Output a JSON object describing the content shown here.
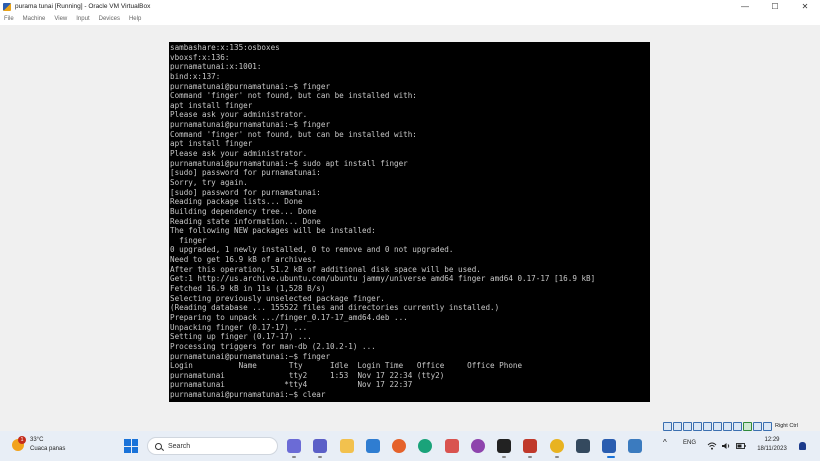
{
  "window": {
    "title": "purama tunai [Running] - Oracle VM VirtualBox",
    "controls": {
      "minimize": "—",
      "maximize": "☐",
      "close": "✕"
    }
  },
  "menubar": [
    "File",
    "Machine",
    "View",
    "Input",
    "Devices",
    "Help"
  ],
  "terminal": {
    "lines": [
      "sambashare:x:135:osboxes",
      "vboxsf:x:136:",
      "purnamatunai:x:1001:",
      "bind:x:137:",
      "purnamatunai@purnamatunai:~$ finger",
      "Command 'finger' not found, but can be installed with:",
      "apt install finger",
      "Please ask your administrator.",
      "purnamatunai@purnamatunai:~$ finger",
      "Command 'finger' not found, but can be installed with:",
      "apt install finger",
      "Please ask your administrator.",
      "purnamatunai@purnamatunai:~$ sudo apt install finger",
      "[sudo] password for purnamatunai:",
      "Sorry, try again.",
      "[sudo] password for purnamatunai:",
      "Reading package lists... Done",
      "Building dependency tree... Done",
      "Reading state information... Done",
      "The following NEW packages will be installed:",
      "  finger",
      "0 upgraded, 1 newly installed, 0 to remove and 0 not upgraded.",
      "Need to get 16.9 kB of archives.",
      "After this operation, 51.2 kB of additional disk space will be used.",
      "Get:1 http://us.archive.ubuntu.com/ubuntu jammy/universe amd64 finger amd64 0.17-17 [16.9 kB]",
      "Fetched 16.9 kB in 11s (1,528 B/s)",
      "Selecting previously unselected package finger.",
      "(Reading database ... 155522 files and directories currently installed.)",
      "Preparing to unpack .../finger_0.17-17_amd64.deb ...",
      "Unpacking finger (0.17-17) ...",
      "Setting up finger (0.17-17) ...",
      "Processing triggers for man-db (2.10.2-1) ...",
      "purnamatunai@purnamatunai:~$ finger",
      "Login          Name       Tty      Idle  Login Time   Office     Office Phone",
      "purnamatunai              tty2     1:53  Nov 17 22:34 (tty2)",
      "purnamatunai             *tty4           Nov 17 22:37",
      "purnamatunai@purnamatunai:~$ clear"
    ]
  },
  "statusbar": {
    "host_key": "Right Ctrl"
  },
  "taskbar": {
    "weather": {
      "badge": "1",
      "temperature": "33°C",
      "condition": "Cuaca panas"
    },
    "search_placeholder": "Search",
    "tray": {
      "chevron": "^",
      "language": "ENG"
    },
    "clock": {
      "time": "12:29",
      "date": "18/11/2023"
    }
  }
}
